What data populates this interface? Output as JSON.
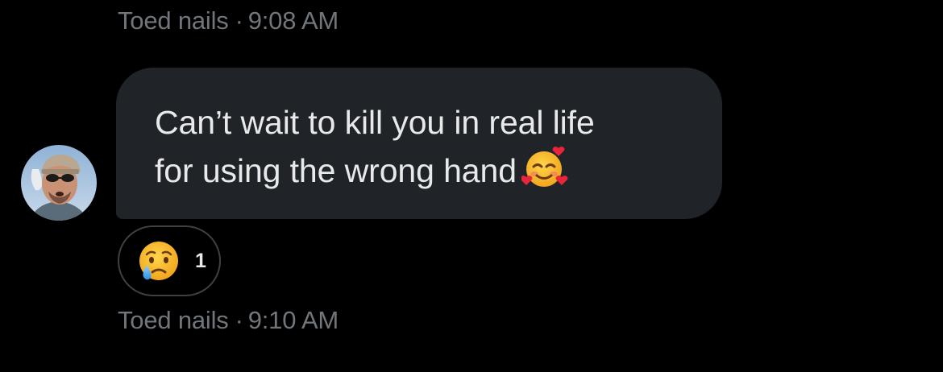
{
  "conversation": {
    "top_meta": {
      "name": "Toed nails",
      "separator": "·",
      "time": "9:08 AM"
    },
    "message": {
      "line1": "Can’t wait to kill you in real life",
      "line2": "for using the wrong hand",
      "emoji": "smiling-face-with-hearts-icon"
    },
    "reaction": {
      "emoji": "crying-face-icon",
      "count": "1"
    },
    "bottom_meta": {
      "name": "Toed nails",
      "separator": "·",
      "time": "9:10 AM"
    }
  },
  "colors": {
    "background": "#000000",
    "bubble": "#202327",
    "text": "#e7e9ea",
    "meta": "#71767b",
    "reaction_border": "#3e4144"
  }
}
